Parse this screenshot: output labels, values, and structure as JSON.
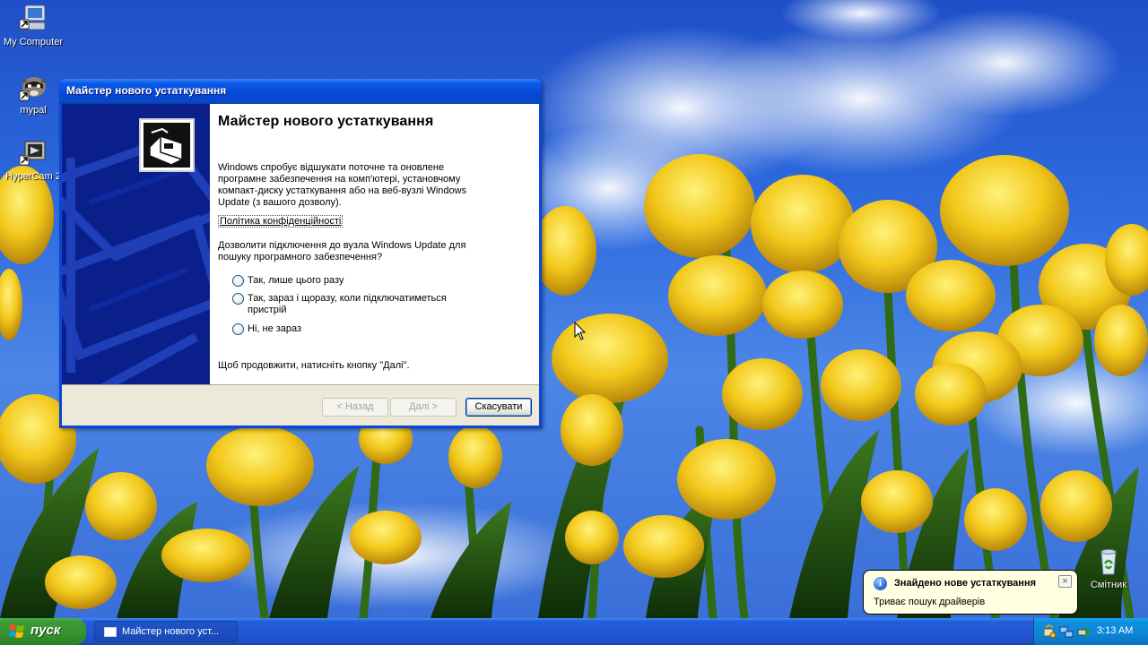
{
  "desktop": {
    "icons": [
      {
        "label": "My Computer",
        "icon": "my-computer-icon"
      },
      {
        "label": "mypal",
        "icon": "mypal-raccoon-icon"
      },
      {
        "label": "HyperCam 2",
        "icon": "hypercam-icon"
      },
      {
        "label": "Смітник",
        "icon": "recycle-bin-icon"
      }
    ]
  },
  "wizard": {
    "window_title": "Майстер нового устаткування",
    "heading": "Майстер нового устаткування",
    "intro": "Windows спробує відшукати поточне та оновлене програмне забезпечення на комп'ютері, установчому компакт-диску устаткування або на веб-вузлі Windows Update (з вашого дозволу).",
    "privacy_link": "Політика конфіденційності",
    "question": "Дозволити підключення до вузла Windows Update для пошуку програмного забезпечення?",
    "options": [
      "Так, лише цього разу",
      "Так, зараз і щоразу, коли підключатиметься пристрій",
      "Ні, не зараз"
    ],
    "hint": "Щоб продовжити, натисніть кнопку \"Далі\".",
    "buttons": {
      "back": "< Назад",
      "next": "Далі >",
      "cancel": "Скасувати"
    }
  },
  "taskbar": {
    "start_label": "пуск",
    "task_label": "Майстер нового уст...",
    "clock": "3:13 AM"
  },
  "balloon": {
    "title": "Знайдено нове устаткування",
    "text": "Триває пошук драйверів",
    "close": "×"
  },
  "colors": {
    "titlebar": "#0a5ae8",
    "taskbar": "#2457d6",
    "start": "#379230",
    "wizard_side": "#0a1f8a",
    "balloon_bg": "#ffffe1"
  }
}
